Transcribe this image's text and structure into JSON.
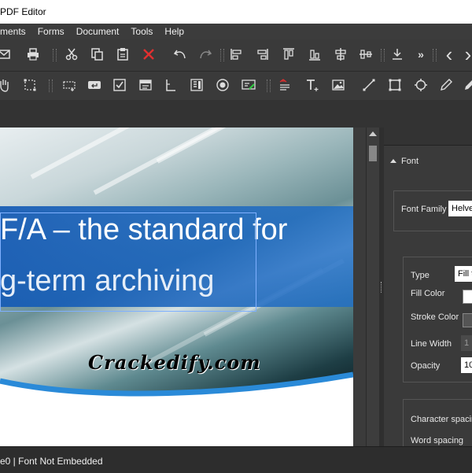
{
  "window": {
    "title": "PDF Editor"
  },
  "menu": [
    "ments",
    "Forms",
    "Document",
    "Tools",
    "Help"
  ],
  "toolbar1": {
    "icons": [
      "mail-icon",
      "print-icon",
      "cut-icon",
      "copy-icon",
      "paste-icon",
      "delete-icon",
      "undo-icon",
      "redo-icon",
      "align-left-icon",
      "align-right-icon",
      "align-top-icon",
      "align-bottom-icon",
      "align-center-icon",
      "align-middle-icon",
      "distribute-icon",
      "more-icon",
      "prev-icon",
      "next-icon"
    ],
    "more_label": "»",
    "prev_label": "‹",
    "next_label": "›"
  },
  "toolbar2": {
    "icons": [
      "hand-icon",
      "crop-icon",
      "field-icon",
      "button-icon",
      "checkbox-icon",
      "combobox-icon",
      "text-field-icon",
      "listbox-icon",
      "radio-icon",
      "signature-icon",
      "text-edit-icon",
      "add-text-icon",
      "add-image-icon",
      "line-icon",
      "rectangle-icon",
      "shape-icon",
      "pen-icon",
      "pencil-icon"
    ]
  },
  "document": {
    "heading_line1": "F/A – the standard for",
    "heading_line2": "g-term archiving",
    "watermark": "Crackedify.com"
  },
  "panel": {
    "section": "Font",
    "font_family_label": "Font Family",
    "font_family_value": "Helve",
    "type_label": "Type",
    "type_value": "Fill t",
    "fill_color_label": "Fill Color",
    "stroke_color_label": "Stroke Color",
    "line_width_label": "Line Width",
    "line_width_value": "1",
    "opacity_label": "Opacity",
    "opacity_value": "10",
    "char_spacing_label": "Character spacin",
    "word_spacing_label": "Word spacing"
  },
  "status": {
    "text": "e0 | Font Not Embedded"
  },
  "colors": {
    "banner": "#1e6ec8",
    "accent_delete": "#e03030",
    "panel_bg": "#3a3a3a"
  }
}
